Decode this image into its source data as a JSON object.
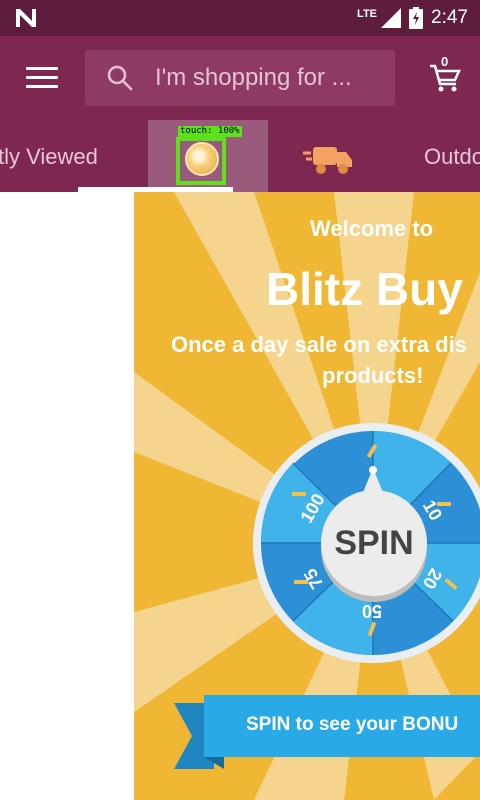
{
  "status_bar": {
    "network": "LTE",
    "time": "2:47"
  },
  "app_bar": {
    "search_placeholder": "I'm shopping for ...",
    "cart_count": "0",
    "icons": [
      "menu-icon",
      "search-icon",
      "cart-icon"
    ]
  },
  "tabs": {
    "items": [
      {
        "label": "tly Viewed"
      },
      {
        "label": "",
        "icon": "coin-icon",
        "selected": true
      },
      {
        "label": "",
        "icon": "delivery-truck-icon"
      },
      {
        "label": "Outdo"
      }
    ]
  },
  "overlay": {
    "touch_label": "touch: 100%",
    "color": "#5ce11a"
  },
  "banner": {
    "welcome": "Welcome to",
    "title": "Blitz Buy",
    "subtitle_line1": "Once a day sale on extra dis",
    "subtitle_line2": "products!",
    "wheel_values": [
      "100",
      "10",
      "20",
      "50",
      "75"
    ],
    "spin_label": "SPIN",
    "cta": "SPIN to see your BONU",
    "colors": {
      "background": "#f0b735",
      "wheel_blue": "#2d8fd6",
      "ribbon": "#29a9e6"
    }
  }
}
